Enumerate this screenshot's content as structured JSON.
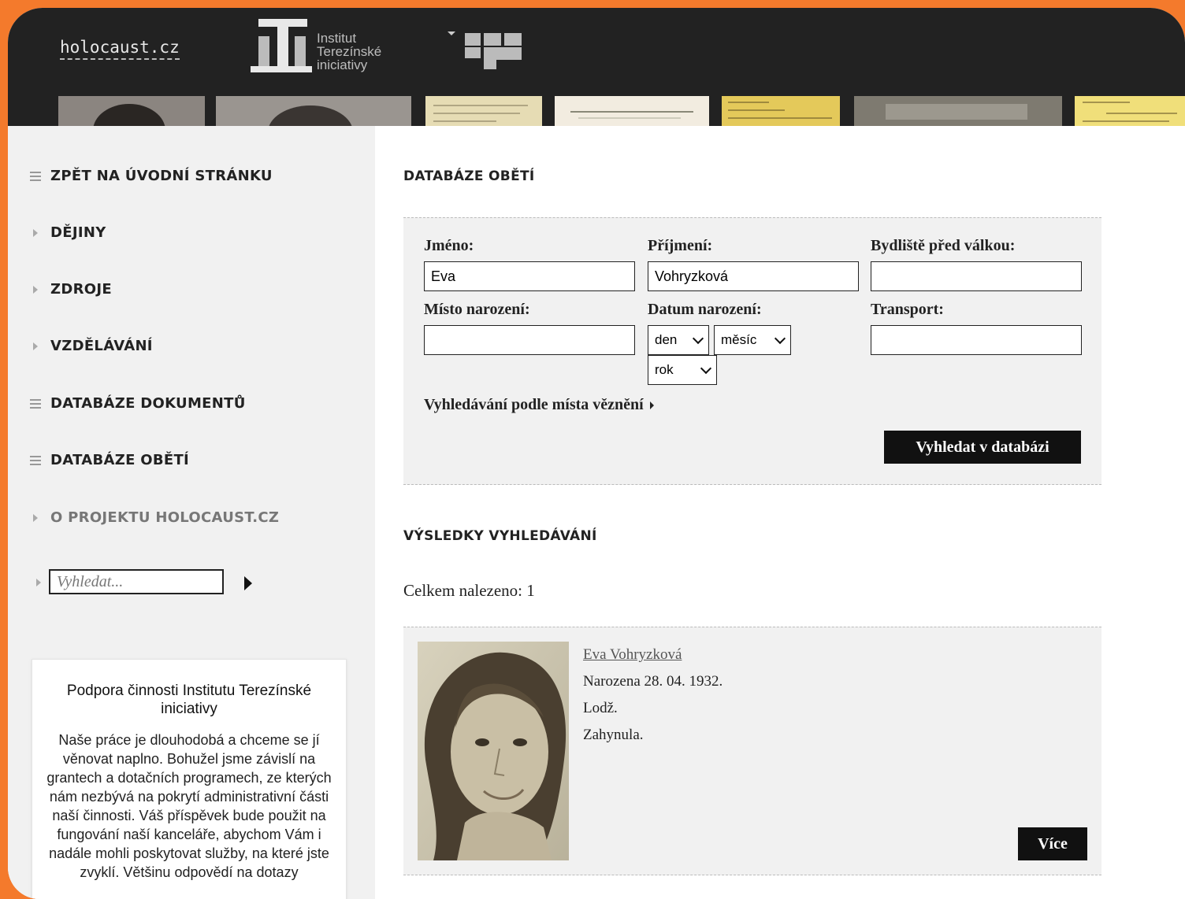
{
  "header": {
    "site_link": "holocaust.cz",
    "logo_lines": [
      "Institut",
      "Terezínské",
      "iniciativy"
    ]
  },
  "sidebar": {
    "items": [
      {
        "label": "ZPĚT NA ÚVODNÍ STRÁNKU",
        "icon": "menu-icon"
      },
      {
        "label": "DĚJINY",
        "icon": "triangle-right-icon"
      },
      {
        "label": "ZDROJE",
        "icon": "triangle-right-icon"
      },
      {
        "label": "VZDĚLÁVÁNÍ",
        "icon": "triangle-right-icon"
      },
      {
        "label": "DATABÁZE DOKUMENTŮ",
        "icon": "menu-icon"
      },
      {
        "label": "DATABÁZE OBĚTÍ",
        "icon": "menu-icon"
      },
      {
        "label": "O PROJEKTU HOLOCAUST.CZ",
        "icon": "triangle-right-icon"
      }
    ],
    "search_placeholder": "Vyhledat...",
    "support": {
      "title": "Podpora činnosti Institutu Terezínské iniciativy",
      "text": "Naše práce je dlouhodobá a chceme se jí věnovat naplno. Bohužel jsme závislí na grantech a dotačních programech, ze kterých nám nezbývá na pokrytí administrativní části naší činnosti. Váš příspěvek bude použit na fungování naší kanceláře, abychom Vám i nadále mohli poskytovat služby, na které jste zvyklí. Většinu odpovědí na dotazy"
    }
  },
  "main": {
    "title": "DATABÁZE OBĚTÍ",
    "form": {
      "first_name_label": "Jméno:",
      "first_name_value": "Eva",
      "last_name_label": "Příjmení:",
      "last_name_value": "Vohryzková",
      "residence_label": "Bydliště před válkou:",
      "residence_value": "",
      "birthplace_label": "Místo narození:",
      "birthplace_value": "",
      "birthdate_label": "Datum narození:",
      "day_select": "den",
      "month_select": "měsíc",
      "year_select": "rok",
      "transport_label": "Transport:",
      "transport_value": "",
      "advanced_link": "Vyhledávání podle místa věznění",
      "search_button": "Vyhledat v databázi"
    },
    "results_title": "VÝSLEDKY VYHLEDÁVÁNÍ",
    "results_count": "Celkem nalezeno: 1",
    "results": [
      {
        "name": "Eva Vohryzková",
        "born": "Narozena 28. 04. 1932.",
        "place": "Lodž.",
        "fate": "Zahynula.",
        "more_button": "Více"
      }
    ]
  }
}
